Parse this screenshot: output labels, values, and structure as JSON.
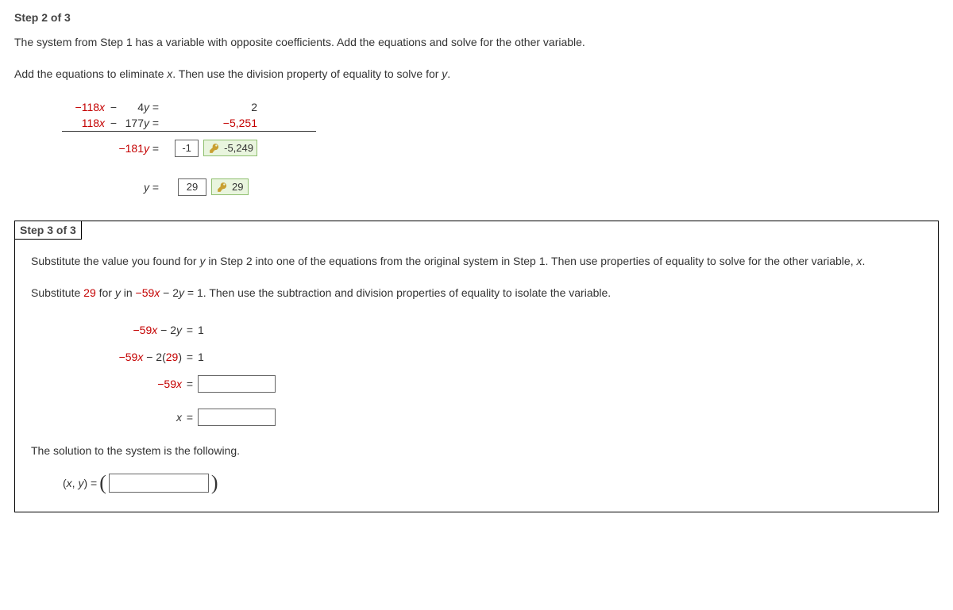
{
  "step2": {
    "title": "Step 2 of 3",
    "desc": "The system from Step 1 has a variable with opposite coefficients. Add the equations and solve for the other variable.",
    "hint_pre": "Add the equations to eliminate ",
    "hint_varx": "x",
    "hint_mid": ". Then use the division property of equality to solve for ",
    "hint_vary": "y",
    "hint_post": ".",
    "eq1_l": "−118",
    "eq1_x": "x",
    "eq1_mid": " − ",
    "eq1_y": "4",
    "eq1_yv": "y",
    "eq1_r": "2",
    "eq2_l": "118",
    "eq2_x": "x",
    "eq2_mid": " − ",
    "eq2_y": "177",
    "eq2_yv": "y",
    "eq2_r": "−5,251",
    "sum_y": "−181",
    "sum_yv": "y",
    "input1": "-1",
    "answer1": "-5,249",
    "y_label": "y",
    "input2": "29",
    "answer2": "29"
  },
  "step3": {
    "title": "Step 3 of 3",
    "desc_pre": "Substitute the value you found for ",
    "desc_y": "y",
    "desc_mid1": " in Step 2 into one of the equations from the original system in Step 1. Then use properties of equality to solve for the other variable, ",
    "desc_x": "x",
    "desc_post1": ".",
    "hint_pre": "Substitute ",
    "hint_val": "29",
    "hint_mid1": " for ",
    "hint_y": "y",
    "hint_mid2": " in ",
    "hint_eq_a": "−59",
    "hint_eq_x": "x",
    "hint_eq_mid": " − 2",
    "hint_eq_y": "y",
    "hint_eq_r": " = 1",
    "hint_post": ".  Then use the subtraction and division properties of equality to isolate the variable.",
    "l1_a": "−59",
    "l1_x": "x",
    "l1_mid": " − 2",
    "l1_y": "y",
    "l1_r": "1",
    "l2_a": "−59",
    "l2_x": "x",
    "l2_mid": " − 2(",
    "l2_val": "29",
    "l2_close": ")",
    "l2_r": "1",
    "l3_a": "−59",
    "l3_x": "x",
    "l4_x": "x",
    "final": "The solution to the system is the following.",
    "sol_pre": "(",
    "sol_x": "x",
    "sol_comma": ", ",
    "sol_y": "y",
    "sol_post": ")",
    "sol_eq": " = "
  }
}
